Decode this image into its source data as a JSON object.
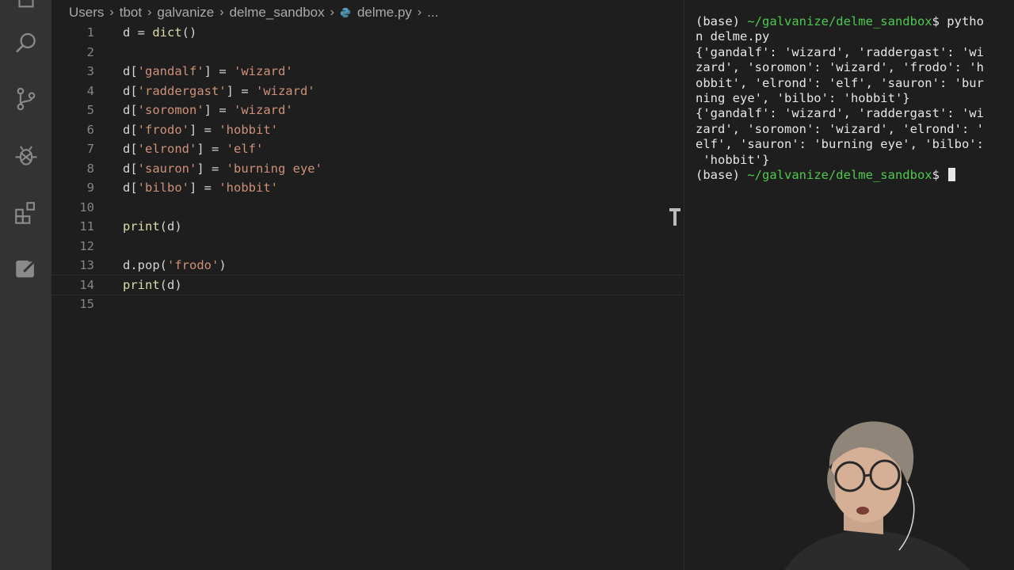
{
  "activity_bar": {
    "icons": [
      "files-icon",
      "search-icon",
      "source-control-icon",
      "debug-icon",
      "extensions-icon",
      "remote-icon"
    ]
  },
  "breadcrumb": {
    "items": [
      "Users",
      "tbot",
      "galvanize",
      "delme_sandbox",
      "delme.py",
      "..."
    ]
  },
  "editor": {
    "lines": [
      {
        "n": "1",
        "text": "d = dict()"
      },
      {
        "n": "2",
        "text": ""
      },
      {
        "n": "3",
        "text": "d['gandalf'] = 'wizard'"
      },
      {
        "n": "4",
        "text": "d['raddergast'] = 'wizard'"
      },
      {
        "n": "5",
        "text": "d['soromon'] = 'wizard'"
      },
      {
        "n": "6",
        "text": "d['frodo'] = 'hobbit'"
      },
      {
        "n": "7",
        "text": "d['elrond'] = 'elf'"
      },
      {
        "n": "8",
        "text": "d['sauron'] = 'burning eye'"
      },
      {
        "n": "9",
        "text": "d['bilbo'] = 'hobbit'"
      },
      {
        "n": "10",
        "text": ""
      },
      {
        "n": "11",
        "text": "print(d)"
      },
      {
        "n": "12",
        "text": ""
      },
      {
        "n": "13",
        "text": "d.pop('frodo')"
      },
      {
        "n": "14",
        "text": "print(d)"
      },
      {
        "n": "15",
        "text": ""
      }
    ],
    "active_line": "14"
  },
  "terminal": {
    "lines": [
      {
        "prefix": "(base) ",
        "path": "~/galvanize/delme_sandbox",
        "text": "$ pytho"
      },
      {
        "prefix": "",
        "path": "",
        "text": "n delme.py"
      },
      {
        "prefix": "",
        "path": "",
        "text": "{'gandalf': 'wizard', 'raddergast': 'wi"
      },
      {
        "prefix": "",
        "path": "",
        "text": "zard', 'soromon': 'wizard', 'frodo': 'h"
      },
      {
        "prefix": "",
        "path": "",
        "text": "obbit', 'elrond': 'elf', 'sauron': 'bur"
      },
      {
        "prefix": "",
        "path": "",
        "text": "ning eye', 'bilbo': 'hobbit'}"
      },
      {
        "prefix": "",
        "path": "",
        "text": "{'gandalf': 'wizard', 'raddergast': 'wi"
      },
      {
        "prefix": "",
        "path": "",
        "text": "zard', 'soromon': 'wizard', 'elrond': '"
      },
      {
        "prefix": "",
        "path": "",
        "text": "elf', 'sauron': 'burning eye', 'bilbo':"
      },
      {
        "prefix": "",
        "path": "",
        "text": " 'hobbit'}"
      },
      {
        "prefix": "(base) ",
        "path": "~/galvanize/delme_sandbox",
        "text": "$ "
      }
    ]
  },
  "colors": {
    "string": "#ce9178",
    "function": "#dcdcaa",
    "terminal_path": "#4ec94e"
  }
}
